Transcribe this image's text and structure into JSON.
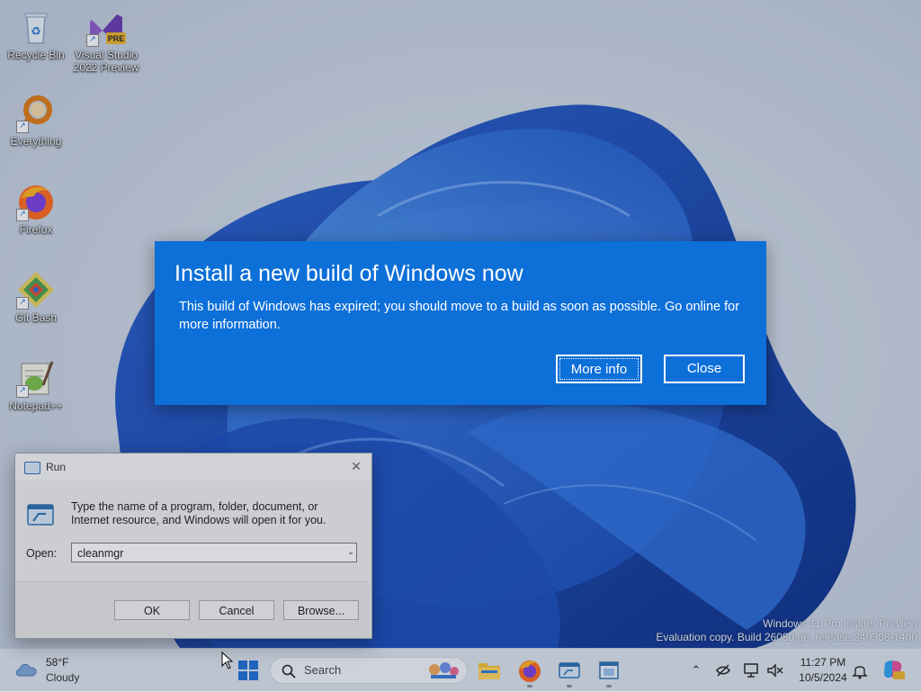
{
  "desktop": {
    "icons": [
      {
        "label": "Recycle Bin",
        "icon": "recycle-bin-icon"
      },
      {
        "label": "Visual Studio 2022 Preview",
        "icon": "visual-studio-icon",
        "badge": "PRE"
      },
      {
        "label": "Everything",
        "icon": "everything-search-icon"
      },
      {
        "label": "Firefox",
        "icon": "firefox-icon"
      },
      {
        "label": "Git Bash",
        "icon": "git-bash-icon"
      },
      {
        "label": "Notepad++",
        "icon": "notepadpp-icon"
      }
    ],
    "watermark": {
      "line1": "Windows 11 Pro Insider Preview",
      "line2": "Evaluation copy. Build 26080.ge_release.240308-1400"
    }
  },
  "install_dialog": {
    "title": "Install a new build of Windows now",
    "body": "This build of Windows has expired; you should move to a build as soon as possible. Go online for more information.",
    "more_info_label": "More info",
    "close_label": "Close",
    "accent": "#0d6fd8"
  },
  "run_dialog": {
    "title": "Run",
    "description": "Type the name of a program, folder, document, or Internet resource, and Windows will open it for you.",
    "open_label": "Open:",
    "open_value": "cleanmgr",
    "ok_label": "OK",
    "cancel_label": "Cancel",
    "browse_label": "Browse..."
  },
  "taskbar": {
    "weather_temp": "58°F",
    "weather_condition": "Cloudy",
    "search_placeholder": "Search",
    "apps": [
      "file-explorer-icon",
      "firefox-icon",
      "run-icon",
      "window-icon"
    ],
    "clock_time": "11:27 PM",
    "clock_date": "10/5/2024"
  }
}
